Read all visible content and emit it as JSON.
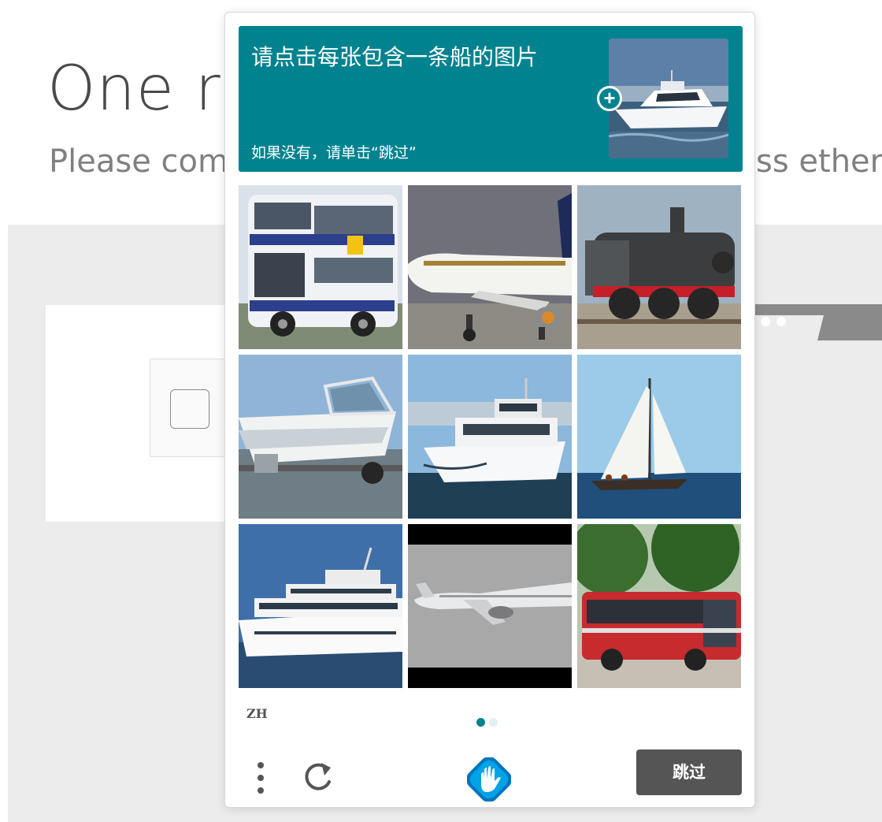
{
  "background": {
    "title": "One r",
    "subtitle": "Please com",
    "subtitle_right": "ss ether"
  },
  "captcha": {
    "prompt": "请点击每张包含一条船的图片",
    "hint": "如果没有，请单击“跳过”",
    "example_alt": "boat",
    "tiles": [
      {
        "subject": "double-decker bus"
      },
      {
        "subject": "airplane"
      },
      {
        "subject": "steam locomotive"
      },
      {
        "subject": "speedboat on trailer"
      },
      {
        "subject": "motor yacht"
      },
      {
        "subject": "sailboat"
      },
      {
        "subject": "super yacht"
      },
      {
        "subject": "airplane in flight"
      },
      {
        "subject": "red bus"
      }
    ],
    "language": "ZH",
    "page_count": 2,
    "page_current": 1,
    "skip_label": "跳过"
  },
  "colors": {
    "accent": "#00838f",
    "skip_button": "#555555"
  }
}
